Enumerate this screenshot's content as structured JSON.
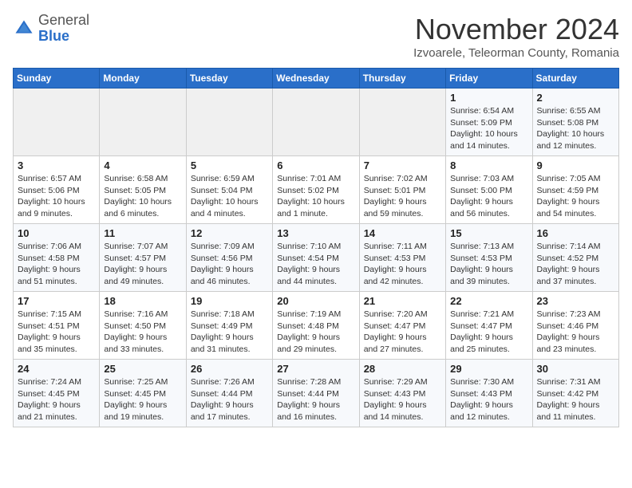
{
  "header": {
    "logo_line1": "General",
    "logo_line2": "Blue",
    "month": "November 2024",
    "location": "Izvoarele, Teleorman County, Romania"
  },
  "weekdays": [
    "Sunday",
    "Monday",
    "Tuesday",
    "Wednesday",
    "Thursday",
    "Friday",
    "Saturday"
  ],
  "weeks": [
    [
      {
        "day": null,
        "info": ""
      },
      {
        "day": null,
        "info": ""
      },
      {
        "day": null,
        "info": ""
      },
      {
        "day": null,
        "info": ""
      },
      {
        "day": null,
        "info": ""
      },
      {
        "day": "1",
        "info": "Sunrise: 6:54 AM\nSunset: 5:09 PM\nDaylight: 10 hours and 14 minutes."
      },
      {
        "day": "2",
        "info": "Sunrise: 6:55 AM\nSunset: 5:08 PM\nDaylight: 10 hours and 12 minutes."
      }
    ],
    [
      {
        "day": "3",
        "info": "Sunrise: 6:57 AM\nSunset: 5:06 PM\nDaylight: 10 hours and 9 minutes."
      },
      {
        "day": "4",
        "info": "Sunrise: 6:58 AM\nSunset: 5:05 PM\nDaylight: 10 hours and 6 minutes."
      },
      {
        "day": "5",
        "info": "Sunrise: 6:59 AM\nSunset: 5:04 PM\nDaylight: 10 hours and 4 minutes."
      },
      {
        "day": "6",
        "info": "Sunrise: 7:01 AM\nSunset: 5:02 PM\nDaylight: 10 hours and 1 minute."
      },
      {
        "day": "7",
        "info": "Sunrise: 7:02 AM\nSunset: 5:01 PM\nDaylight: 9 hours and 59 minutes."
      },
      {
        "day": "8",
        "info": "Sunrise: 7:03 AM\nSunset: 5:00 PM\nDaylight: 9 hours and 56 minutes."
      },
      {
        "day": "9",
        "info": "Sunrise: 7:05 AM\nSunset: 4:59 PM\nDaylight: 9 hours and 54 minutes."
      }
    ],
    [
      {
        "day": "10",
        "info": "Sunrise: 7:06 AM\nSunset: 4:58 PM\nDaylight: 9 hours and 51 minutes."
      },
      {
        "day": "11",
        "info": "Sunrise: 7:07 AM\nSunset: 4:57 PM\nDaylight: 9 hours and 49 minutes."
      },
      {
        "day": "12",
        "info": "Sunrise: 7:09 AM\nSunset: 4:56 PM\nDaylight: 9 hours and 46 minutes."
      },
      {
        "day": "13",
        "info": "Sunrise: 7:10 AM\nSunset: 4:54 PM\nDaylight: 9 hours and 44 minutes."
      },
      {
        "day": "14",
        "info": "Sunrise: 7:11 AM\nSunset: 4:53 PM\nDaylight: 9 hours and 42 minutes."
      },
      {
        "day": "15",
        "info": "Sunrise: 7:13 AM\nSunset: 4:53 PM\nDaylight: 9 hours and 39 minutes."
      },
      {
        "day": "16",
        "info": "Sunrise: 7:14 AM\nSunset: 4:52 PM\nDaylight: 9 hours and 37 minutes."
      }
    ],
    [
      {
        "day": "17",
        "info": "Sunrise: 7:15 AM\nSunset: 4:51 PM\nDaylight: 9 hours and 35 minutes."
      },
      {
        "day": "18",
        "info": "Sunrise: 7:16 AM\nSunset: 4:50 PM\nDaylight: 9 hours and 33 minutes."
      },
      {
        "day": "19",
        "info": "Sunrise: 7:18 AM\nSunset: 4:49 PM\nDaylight: 9 hours and 31 minutes."
      },
      {
        "day": "20",
        "info": "Sunrise: 7:19 AM\nSunset: 4:48 PM\nDaylight: 9 hours and 29 minutes."
      },
      {
        "day": "21",
        "info": "Sunrise: 7:20 AM\nSunset: 4:47 PM\nDaylight: 9 hours and 27 minutes."
      },
      {
        "day": "22",
        "info": "Sunrise: 7:21 AM\nSunset: 4:47 PM\nDaylight: 9 hours and 25 minutes."
      },
      {
        "day": "23",
        "info": "Sunrise: 7:23 AM\nSunset: 4:46 PM\nDaylight: 9 hours and 23 minutes."
      }
    ],
    [
      {
        "day": "24",
        "info": "Sunrise: 7:24 AM\nSunset: 4:45 PM\nDaylight: 9 hours and 21 minutes."
      },
      {
        "day": "25",
        "info": "Sunrise: 7:25 AM\nSunset: 4:45 PM\nDaylight: 9 hours and 19 minutes."
      },
      {
        "day": "26",
        "info": "Sunrise: 7:26 AM\nSunset: 4:44 PM\nDaylight: 9 hours and 17 minutes."
      },
      {
        "day": "27",
        "info": "Sunrise: 7:28 AM\nSunset: 4:44 PM\nDaylight: 9 hours and 16 minutes."
      },
      {
        "day": "28",
        "info": "Sunrise: 7:29 AM\nSunset: 4:43 PM\nDaylight: 9 hours and 14 minutes."
      },
      {
        "day": "29",
        "info": "Sunrise: 7:30 AM\nSunset: 4:43 PM\nDaylight: 9 hours and 12 minutes."
      },
      {
        "day": "30",
        "info": "Sunrise: 7:31 AM\nSunset: 4:42 PM\nDaylight: 9 hours and 11 minutes."
      }
    ]
  ]
}
